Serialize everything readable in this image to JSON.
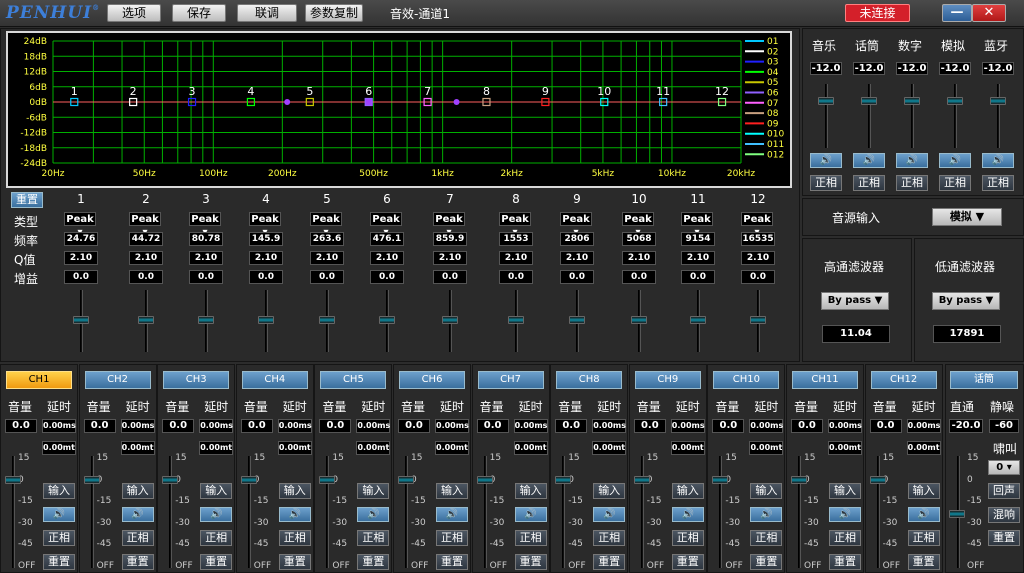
{
  "app": {
    "logo": "PENHUI",
    "logo_mark": "®",
    "title": "音效-通道1",
    "connection": "未连接",
    "min": "—",
    "close": "✕"
  },
  "menu": [
    "选项",
    "保存",
    "联调",
    "参数复制"
  ],
  "eq": {
    "db_labels": [
      "24dB",
      "18dB",
      "12dB",
      "6dB",
      "0dB",
      "-6dB",
      "-12dB",
      "-18dB",
      "-24dB"
    ],
    "freq_labels": [
      "20Hz",
      "50Hz",
      "100Hz",
      "200Hz",
      "500Hz",
      "1kHz",
      "2kHz",
      "5kHz",
      "10kHz",
      "20kHz"
    ],
    "legend": [
      "01",
      "02",
      "03",
      "04",
      "05",
      "06",
      "07",
      "08",
      "09",
      "010",
      "011",
      "012"
    ],
    "legend_colors": [
      "#00c8ff",
      "#ffffff",
      "#2020ff",
      "#00ff00",
      "#c8c800",
      "#9060ff",
      "#ff60ff",
      "#c8a080",
      "#ff2020",
      "#00ffff",
      "#40c0ff",
      "#80ff80"
    ],
    "point_labels": [
      "1",
      "2",
      "3",
      "4",
      "5",
      "6",
      "7",
      "8",
      "9",
      "10",
      "11",
      "12"
    ],
    "reset": "重置",
    "row_labels": [
      "类型",
      "频率",
      "Q值",
      "增益"
    ],
    "bands": [
      {
        "num": "1",
        "type": "Peak",
        "freq": "24.76",
        "q": "2.10",
        "gain": "0.0"
      },
      {
        "num": "2",
        "type": "Peak",
        "freq": "44.72",
        "q": "2.10",
        "gain": "0.0"
      },
      {
        "num": "3",
        "type": "Peak",
        "freq": "80.78",
        "q": "2.10",
        "gain": "0.0"
      },
      {
        "num": "4",
        "type": "Peak",
        "freq": "145.9",
        "q": "2.10",
        "gain": "0.0"
      },
      {
        "num": "5",
        "type": "Peak",
        "freq": "263.6",
        "q": "2.10",
        "gain": "0.0"
      },
      {
        "num": "6",
        "type": "Peak",
        "freq": "476.1",
        "q": "2.10",
        "gain": "0.0"
      },
      {
        "num": "7",
        "type": "Peak",
        "freq": "859.9",
        "q": "2.10",
        "gain": "0.0"
      },
      {
        "num": "8",
        "type": "Peak",
        "freq": "1553",
        "q": "2.10",
        "gain": "0.0"
      },
      {
        "num": "9",
        "type": "Peak",
        "freq": "2806",
        "q": "2.10",
        "gain": "0.0"
      },
      {
        "num": "10",
        "type": "Peak",
        "freq": "5068",
        "q": "2.10",
        "gain": "0.0"
      },
      {
        "num": "11",
        "type": "Peak",
        "freq": "9154",
        "q": "2.10",
        "gain": "0.0"
      },
      {
        "num": "12",
        "type": "Peak",
        "freq": "16535",
        "q": "2.10",
        "gain": "0.0"
      }
    ]
  },
  "sources": {
    "items": [
      {
        "name": "音乐",
        "value": "-12.0",
        "phase": "正相"
      },
      {
        "name": "话筒",
        "value": "-12.0",
        "phase": "正相"
      },
      {
        "name": "数字",
        "value": "-12.0",
        "phase": "正相"
      },
      {
        "name": "模拟",
        "value": "-12.0",
        "phase": "正相"
      },
      {
        "name": "蓝牙",
        "value": "-12.0",
        "phase": "正相"
      }
    ],
    "input_label": "音源输入",
    "input_value": "模拟"
  },
  "filters": {
    "hp": {
      "title": "高通滤波器",
      "type": "By pass",
      "value": "11.04"
    },
    "lp": {
      "title": "低通滤波器",
      "type": "By pass",
      "value": "17891"
    }
  },
  "channels": {
    "vol_label": "音量",
    "delay_label": "延时",
    "scale": [
      "15",
      "0",
      "-15",
      "-30",
      "-45",
      "OFF"
    ],
    "input": "输入",
    "phase": "正相",
    "reset": "重置",
    "items": [
      {
        "name": "CH1",
        "vol": "0.0",
        "delay_ms": "0.00ms",
        "delay_mt": "0.00mt"
      },
      {
        "name": "CH2",
        "vol": "0.0",
        "delay_ms": "0.00ms",
        "delay_mt": "0.00mt"
      },
      {
        "name": "CH3",
        "vol": "0.0",
        "delay_ms": "0.00ms",
        "delay_mt": "0.00mt"
      },
      {
        "name": "CH4",
        "vol": "0.0",
        "delay_ms": "0.00ms",
        "delay_mt": "0.00mt"
      },
      {
        "name": "CH5",
        "vol": "0.0",
        "delay_ms": "0.00ms",
        "delay_mt": "0.00mt"
      },
      {
        "name": "CH6",
        "vol": "0.0",
        "delay_ms": "0.00ms",
        "delay_mt": "0.00mt"
      },
      {
        "name": "CH7",
        "vol": "0.0",
        "delay_ms": "0.00ms",
        "delay_mt": "0.00mt"
      },
      {
        "name": "CH8",
        "vol": "0.0",
        "delay_ms": "0.00ms",
        "delay_mt": "0.00mt"
      },
      {
        "name": "CH9",
        "vol": "0.0",
        "delay_ms": "0.00ms",
        "delay_mt": "0.00mt"
      },
      {
        "name": "CH10",
        "vol": "0.0",
        "delay_ms": "0.00ms",
        "delay_mt": "0.00mt"
      },
      {
        "name": "CH11",
        "vol": "0.0",
        "delay_ms": "0.00ms",
        "delay_mt": "0.00mt"
      },
      {
        "name": "CH12",
        "vol": "0.0",
        "delay_ms": "0.00ms",
        "delay_mt": "0.00mt"
      }
    ]
  },
  "mic": {
    "button": "话筒",
    "direct_label": "直通",
    "noise_label": "静噪",
    "direct": "-20.0",
    "noise": "-60",
    "howl_label": "啸叫",
    "howl_value": "0",
    "echo": "回声",
    "reverb": "混响",
    "reset": "重置",
    "scale": [
      "15",
      "0",
      "-15",
      "-30",
      "-45",
      "OFF"
    ]
  },
  "colors": {
    "accent": "#3a6f9e",
    "active": "#f09a10",
    "danger": "#d4202a",
    "grid": "#00c800"
  }
}
